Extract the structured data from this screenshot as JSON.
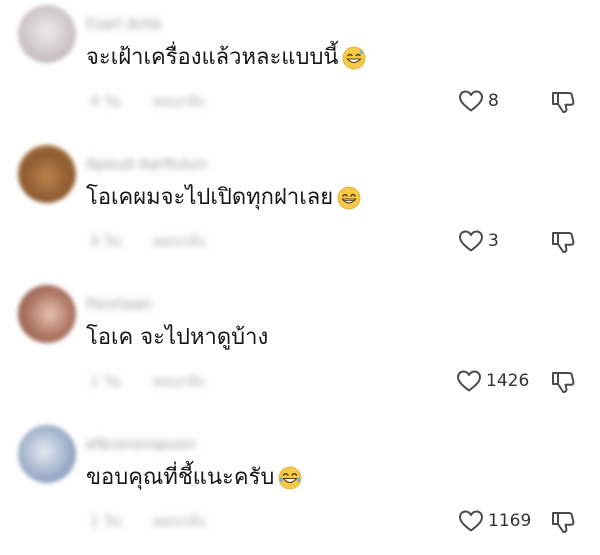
{
  "comments": [
    {
      "username": "Fsarl Ante",
      "text": "จะเฝ้าเครื่องแล้วหละแบบนี้",
      "emoji": "sweat-smile-emoji",
      "time": "4 วัน",
      "reply": "ตอบกลับ",
      "likes": "8",
      "avatar_colors": [
        "#e8e4e6",
        "#c9c0c4",
        "#b9aeb0"
      ]
    },
    {
      "username": "Apoud Aarltulun",
      "text": "โอเคผมจะไปเปิดทุกฝาเลย",
      "emoji": "grin-emoji",
      "time": "4 วัน",
      "reply": "ตอบกลับ",
      "likes": "3",
      "avatar_colors": [
        "#b07a45",
        "#8c5a2e",
        "#d4a06a"
      ]
    },
    {
      "username": "Ponrlaan",
      "text": "โอเค จะไปหาดูบ้าง",
      "emoji": "",
      "time": "1 วัน",
      "reply": "ตอบกลับ",
      "likes": "1426",
      "avatar_colors": [
        "#c99a86",
        "#9c6a58",
        "#e6c3b2"
      ]
    },
    {
      "username": "eNconsnspuon",
      "text": "ขอบคุณที่ชี้แนะครับ",
      "emoji": "joy-emoji",
      "time": "1 วัน",
      "reply": "ตอบกลับ",
      "likes": "1169",
      "avatar_colors": [
        "#aab9d2",
        "#7e8fae",
        "#dfe5ee"
      ]
    }
  ]
}
